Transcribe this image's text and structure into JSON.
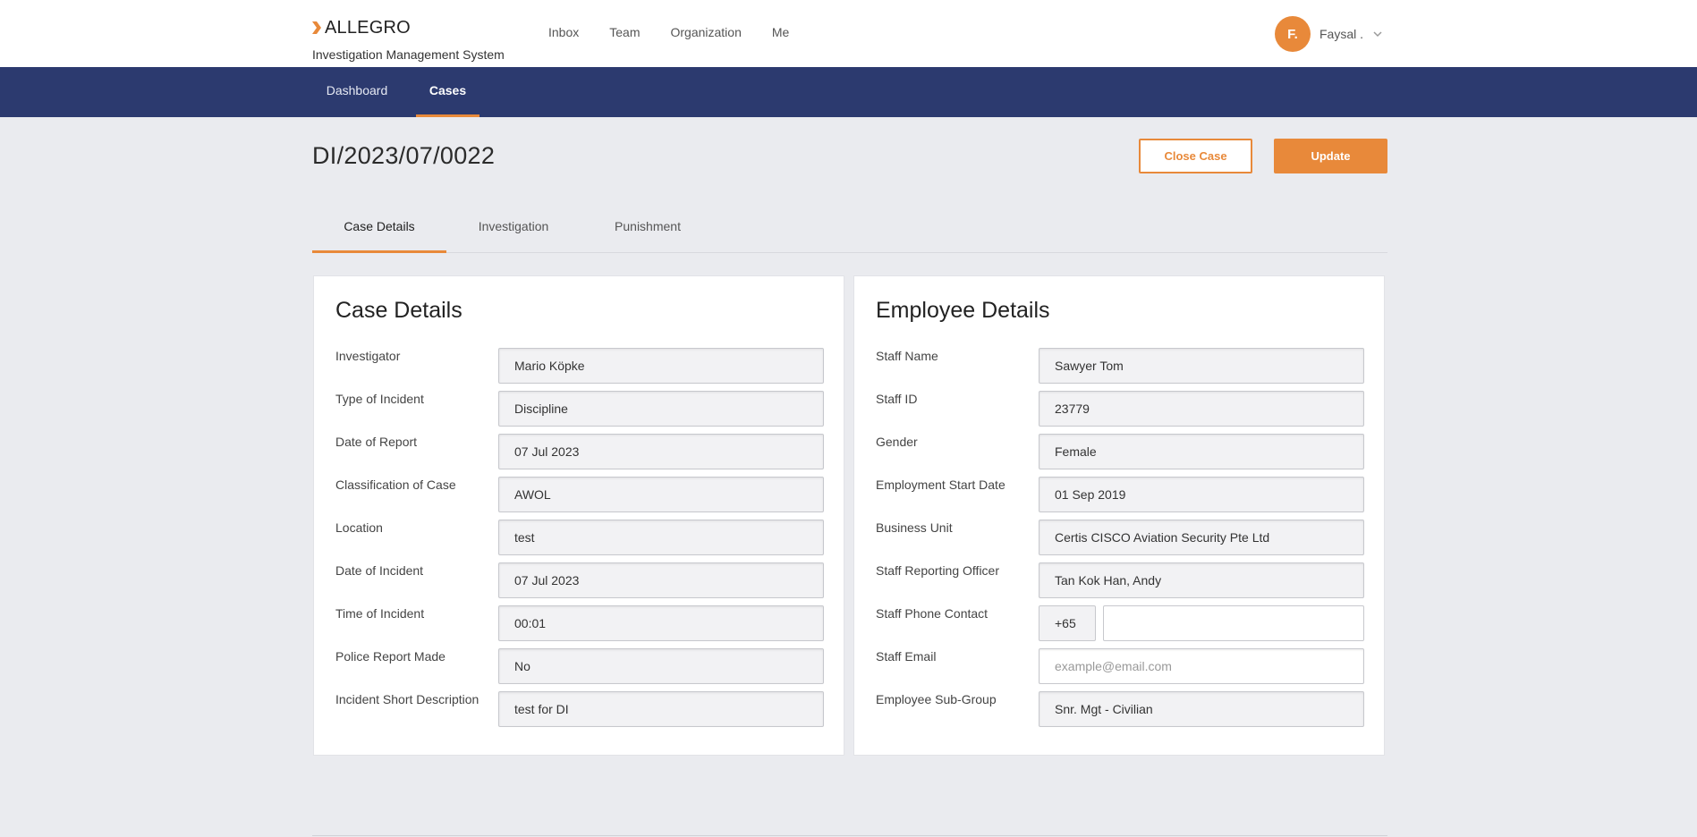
{
  "header": {
    "brand_name": "ALLEGRO",
    "brand_subtitle": "Investigation Management System",
    "nav": [
      "Inbox",
      "Team",
      "Organization",
      "Me"
    ],
    "user_initial": "F.",
    "user_name": "Faysal ."
  },
  "subnav": {
    "items": [
      "Dashboard",
      "Cases"
    ],
    "active": "Cases"
  },
  "page": {
    "case_id": "DI/2023/07/0022",
    "close_case_label": "Close Case",
    "update_label": "Update"
  },
  "tabs": {
    "items": [
      "Case Details",
      "Investigation",
      "Punishment"
    ],
    "active": "Case Details"
  },
  "case_details": {
    "title": "Case Details",
    "fields": [
      {
        "label": "Investigator",
        "value": "Mario  Köpke"
      },
      {
        "label": "Type of Incident",
        "value": "Discipline"
      },
      {
        "label": "Date of Report",
        "value": "07 Jul 2023"
      },
      {
        "label": "Classification of Case",
        "value": "AWOL"
      },
      {
        "label": "Location",
        "value": "test"
      },
      {
        "label": "Date of Incident",
        "value": "07 Jul 2023"
      },
      {
        "label": "Time of Incident",
        "value": "00:01"
      },
      {
        "label": "Police Report Made",
        "value": "No"
      },
      {
        "label": "Incident Short Description",
        "value": "test for DI"
      }
    ]
  },
  "employee_details": {
    "title": "Employee Details",
    "fields": [
      {
        "label": "Staff Name",
        "value": "Sawyer Tom"
      },
      {
        "label": "Staff ID",
        "value": "23779"
      },
      {
        "label": "Gender",
        "value": "Female"
      },
      {
        "label": "Employment Start Date",
        "value": "01 Sep 2019"
      },
      {
        "label": "Business Unit",
        "value": "Certis CISCO Aviation Security Pte Ltd"
      },
      {
        "label": "Staff Reporting Officer",
        "value": "Tan Kok Han, Andy"
      },
      {
        "label": "Staff Phone Contact",
        "code": "+65",
        "value": ""
      },
      {
        "label": "Staff Email",
        "placeholder": "example@email.com",
        "value": ""
      },
      {
        "label": "Employee Sub-Group",
        "value": "Snr. Mgt - Civilian"
      }
    ]
  },
  "colors": {
    "accent": "#e8893a",
    "navbar": "#2c3a6f",
    "page_bg": "#eaebef"
  }
}
